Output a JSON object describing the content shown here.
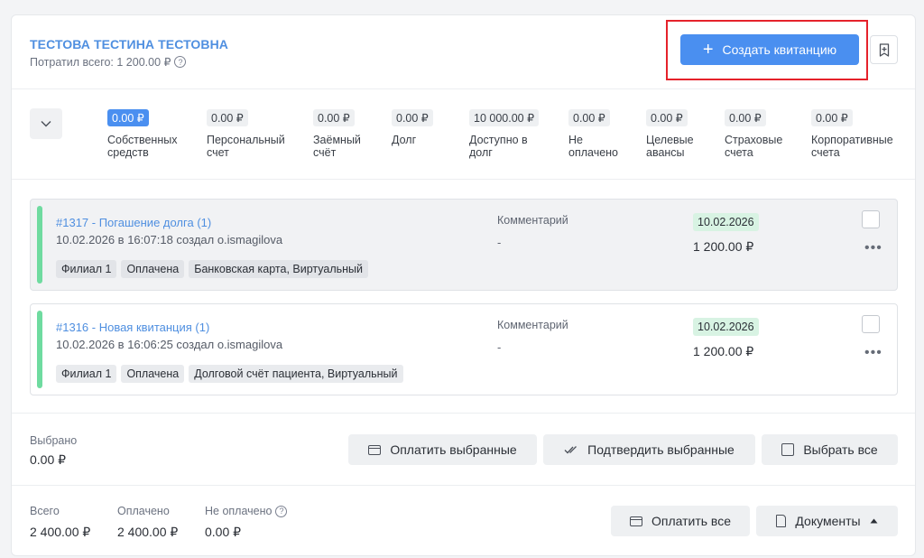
{
  "header": {
    "patient_name": "ТЕСТОВА ТЕСТИНА ТЕСТОВНА",
    "spent_label": "Потратил всего: 1 200.00 ₽",
    "create_button": "Создать квитанцию"
  },
  "accounts": [
    {
      "amount": "0.00 ₽",
      "label": "Собственных\nсредств",
      "active": true
    },
    {
      "amount": "0.00 ₽",
      "label": "Персональный\nсчет"
    },
    {
      "amount": "0.00 ₽",
      "label": "Заёмный\nсчёт"
    },
    {
      "amount": "0.00 ₽",
      "label": "Долг"
    },
    {
      "amount": "10 000.00 ₽",
      "label": "Доступно в\nдолг"
    },
    {
      "amount": "0.00 ₽",
      "label": "Не\nоплачено"
    },
    {
      "amount": "0.00 ₽",
      "label": "Целевые\nавансы"
    },
    {
      "amount": "0.00 ₽",
      "label": "Страховые\nсчета"
    },
    {
      "amount": "0.00 ₽",
      "label": "Корпоративные\nсчета"
    }
  ],
  "receipts": [
    {
      "title": "#1317 - Погашение долга (1)",
      "meta": "10.02.2026 в 16:07:18 создал o.ismagilova",
      "tags": [
        "Филиал 1",
        "Оплачена",
        "Банковская карта, Виртуальный"
      ],
      "comment_label": "Комментарий",
      "comment": "-",
      "date": "10.02.2026",
      "sum": "1 200.00 ₽"
    },
    {
      "title": "#1316 - Новая квитанция (1)",
      "meta": "10.02.2026 в 16:06:25 создал o.ismagilova",
      "tags": [
        "Филиал 1",
        "Оплачена",
        "Долговой счёт пациента, Виртуальный"
      ],
      "comment_label": "Комментарий",
      "comment": "-",
      "date": "10.02.2026",
      "sum": "1 200.00 ₽"
    }
  ],
  "selected": {
    "label": "Выбрано",
    "value": "0.00 ₽",
    "pay_selected": "Оплатить выбранные",
    "confirm_selected": "Подтвердить выбранные",
    "select_all": "Выбрать все"
  },
  "totals": {
    "total_label": "Всего",
    "total_value": "2 400.00 ₽",
    "paid_label": "Оплачено",
    "paid_value": "2 400.00 ₽",
    "unpaid_label": "Не оплачено",
    "unpaid_value": "0.00 ₽",
    "pay_all": "Оплатить все",
    "documents": "Документы"
  },
  "colors": {
    "accent": "#4a8ff0",
    "link": "#4f8fe0",
    "status_bar": "#6fdba0",
    "date_badge": "#d8f3e3",
    "highlight_border": "#e5222b"
  }
}
